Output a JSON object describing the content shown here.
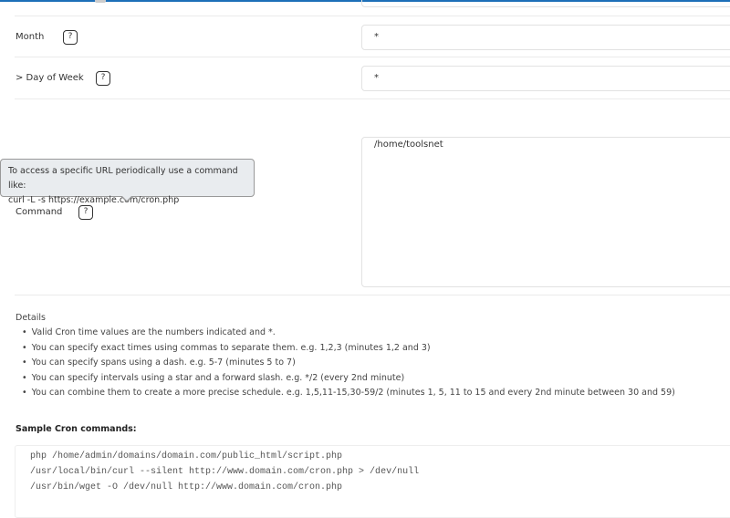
{
  "fields": [
    {
      "label": "Month",
      "value": "*"
    },
    {
      "label": "> Day of Week",
      "value": "*"
    },
    {
      "label": "Command",
      "value": "/home/toolsnet"
    }
  ],
  "help_icon": "?",
  "tooltip": {
    "line1": "To access a specific URL periodically use a command like:",
    "line2": "curl -L -s https://example.com/cron.php"
  },
  "details": {
    "title": "Details",
    "items": [
      "Valid Cron time values are the numbers indicated and *.",
      "You can specify exact times using commas to separate them. e.g. 1,2,3 (minutes 1,2 and 3)",
      "You can specify spans using a dash. e.g. 5-7 (minutes 5 to 7)",
      "You can specify intervals using a star and a forward slash. e.g. */2 (every 2nd minute)",
      "You can combine them to create a more precise schedule. e.g. 1,5,11-15,30-59/2 (minutes 1, 5, 11 to 15 and every 2nd minute between 30 and 59)"
    ]
  },
  "samples": {
    "title": "Sample Cron commands:",
    "lines": [
      "php /home/admin/domains/domain.com/public_html/script.php",
      "/usr/local/bin/curl --silent http://www.domain.com/cron.php > /dev/null",
      "/usr/bin/wget -O /dev/null http://www.domain.com/cron.php"
    ]
  },
  "colors": {
    "accent": "#1d6fb8"
  }
}
